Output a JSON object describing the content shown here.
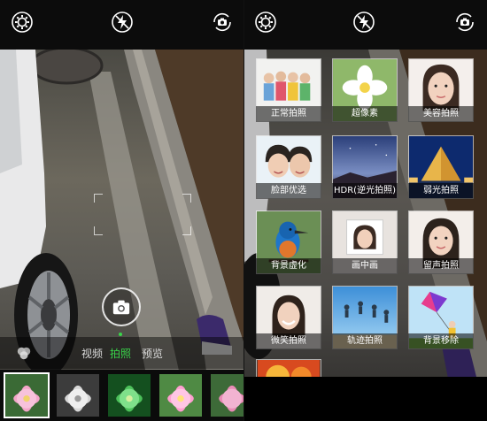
{
  "left_screen": {
    "topbar": {
      "icons": [
        "settings-icon",
        "flash-off-icon",
        "switch-camera-icon"
      ]
    },
    "modes": [
      {
        "label": "视频",
        "active": false
      },
      {
        "label": "拍照",
        "active": true
      },
      {
        "label": "预览",
        "active": false
      }
    ],
    "thumbnails": [
      {
        "name": "pink-lotus",
        "selected": true
      },
      {
        "name": "grayscale-lotus",
        "selected": false
      },
      {
        "name": "green-lotus",
        "selected": false
      },
      {
        "name": "pink-lotus-bright",
        "selected": false
      },
      {
        "name": "pink-lotus-partial",
        "selected": false
      }
    ]
  },
  "right_screen": {
    "topbar": {
      "icons": [
        "settings-icon",
        "flash-off-icon",
        "switch-camera-icon"
      ]
    },
    "scenes": [
      {
        "label": "正常拍照"
      },
      {
        "label": "超像素"
      },
      {
        "label": "美容拍照"
      },
      {
        "label": "脸部优选"
      },
      {
        "label": "HDR(逆光拍照)"
      },
      {
        "label": "弱光拍照"
      },
      {
        "label": "背景虚化"
      },
      {
        "label": "画中画"
      },
      {
        "label": "留声拍照"
      },
      {
        "label": "微笑拍照"
      },
      {
        "label": "轨迹拍照"
      },
      {
        "label": "背景移除"
      }
    ]
  },
  "colors": {
    "accent": "#39d64a",
    "topbar": "#0c0c0c"
  }
}
